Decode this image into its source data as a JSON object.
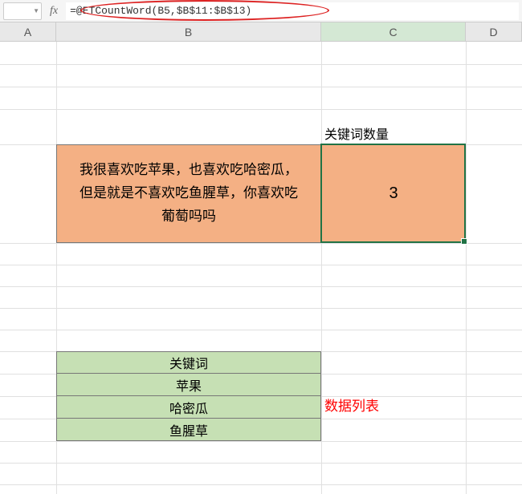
{
  "formula_bar": {
    "fx_label": "fx",
    "formula": "=@ETCountWord(B5,$B$11:$B$13)"
  },
  "columns": {
    "A": "A",
    "B": "B",
    "C": "C",
    "D": "D"
  },
  "keyword_count_header": "关键词数量",
  "orange": {
    "text": "我很喜欢吃苹果，也喜欢吃哈密瓜，但是就是不喜欢吃鱼腥草，你喜欢吃葡萄吗吗",
    "result": "3"
  },
  "green_table": {
    "header": "关键词",
    "rows": [
      "苹果",
      "哈密瓜",
      "鱼腥草"
    ]
  },
  "annotation": "数据列表",
  "chart_data": {
    "type": "table",
    "title": "关键词",
    "categories": [
      "苹果",
      "哈密瓜",
      "鱼腥草"
    ],
    "values": [],
    "result_label": "关键词数量",
    "result_value": 3
  }
}
